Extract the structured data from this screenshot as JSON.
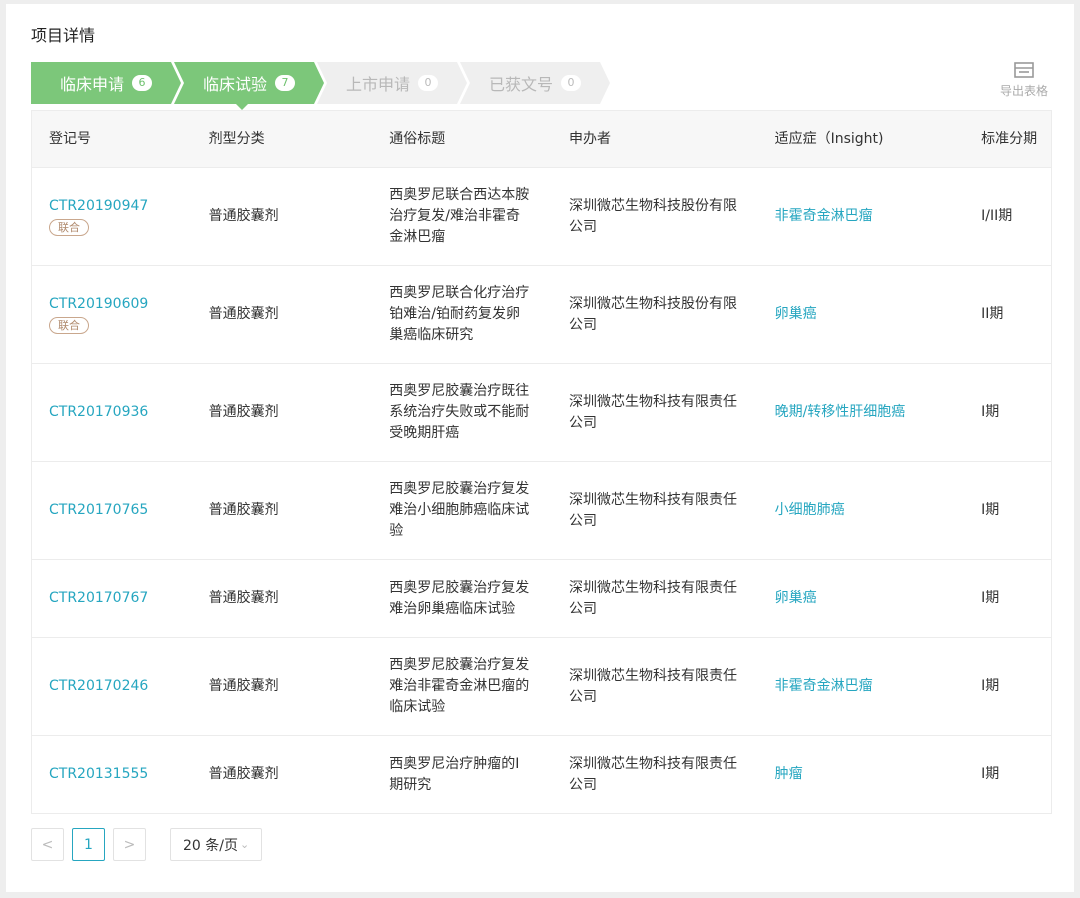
{
  "page": {
    "title": "项目详情"
  },
  "steps": [
    {
      "label": "临床申请",
      "count": "6",
      "active": true
    },
    {
      "label": "临床试验",
      "count": "7",
      "active": true
    },
    {
      "label": "上市申请",
      "count": "0",
      "active": false
    },
    {
      "label": "已获文号",
      "count": "0",
      "active": false
    }
  ],
  "colors": {
    "active_step": "#7cc77a",
    "inactive_step": "#efefef",
    "link": "#26a6c0"
  },
  "export": {
    "label": "导出表格",
    "icon": "table-export-icon"
  },
  "table": {
    "headers": [
      "登记号",
      "剂型分类",
      "通俗标题",
      "申办者",
      "适应症（Insight)",
      "标准分期"
    ],
    "rows": [
      {
        "id": "CTR20190947",
        "tag": "联合",
        "form": "普通胶囊剂",
        "title_lines": [
          "西奥罗尼联合西达本胺",
          "治疗复发/难治非霍奇",
          "金淋巴瘤"
        ],
        "sponsor_lines": [
          "深圳微芯生物科技股份有限",
          "公司"
        ],
        "indication": "非霍奇金淋巴瘤",
        "phase": "I/II期"
      },
      {
        "id": "CTR20190609",
        "tag": "联合",
        "form": "普通胶囊剂",
        "title_lines": [
          "西奥罗尼联合化疗治疗",
          "铂难治/铂耐药复发卵",
          "巢癌临床研究"
        ],
        "sponsor_lines": [
          "深圳微芯生物科技股份有限",
          "公司"
        ],
        "indication": "卵巢癌",
        "phase": "II期"
      },
      {
        "id": "CTR20170936",
        "tag": "",
        "form": "普通胶囊剂",
        "title_lines": [
          "西奥罗尼胶囊治疗既往",
          "系统治疗失败或不能耐",
          "受晚期肝癌"
        ],
        "sponsor_lines": [
          "深圳微芯生物科技有限责任",
          "公司"
        ],
        "indication": "晚期/转移性肝细胞癌",
        "phase": "I期"
      },
      {
        "id": "CTR20170765",
        "tag": "",
        "form": "普通胶囊剂",
        "title_lines": [
          "西奥罗尼胶囊治疗复发",
          "难治小细胞肺癌临床试",
          "验"
        ],
        "sponsor_lines": [
          "深圳微芯生物科技有限责任",
          "公司"
        ],
        "indication": "小细胞肺癌",
        "phase": "I期"
      },
      {
        "id": "CTR20170767",
        "tag": "",
        "form": "普通胶囊剂",
        "title_lines": [
          "西奥罗尼胶囊治疗复发",
          "难治卵巢癌临床试验"
        ],
        "sponsor_lines": [
          "深圳微芯生物科技有限责任",
          "公司"
        ],
        "indication": "卵巢癌",
        "phase": "I期"
      },
      {
        "id": "CTR20170246",
        "tag": "",
        "form": "普通胶囊剂",
        "title_lines": [
          "西奥罗尼胶囊治疗复发",
          "难治非霍奇金淋巴瘤的",
          "临床试验"
        ],
        "sponsor_lines": [
          "深圳微芯生物科技有限责任",
          "公司"
        ],
        "indication": "非霍奇金淋巴瘤",
        "phase": "I期"
      },
      {
        "id": "CTR20131555",
        "tag": "",
        "form": "普通胶囊剂",
        "title_lines": [
          "西奥罗尼治疗肿瘤的I",
          "期研究"
        ],
        "sponsor_lines": [
          "深圳微芯生物科技有限责任",
          "公司"
        ],
        "indication": "肿瘤",
        "phase": "I期"
      }
    ]
  },
  "pager": {
    "prev": "<",
    "current": "1",
    "next": ">",
    "page_size": "20 条/页"
  }
}
